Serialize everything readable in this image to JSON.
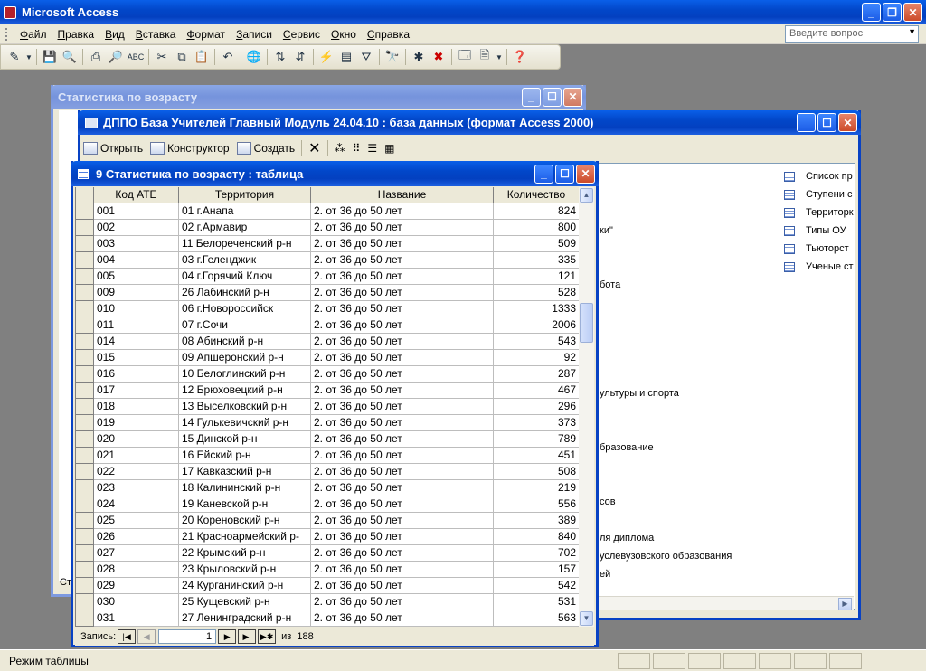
{
  "app": {
    "title": "Microsoft Access",
    "menu": [
      "Файл",
      "Правка",
      "Вид",
      "Вставка",
      "Формат",
      "Записи",
      "Сервис",
      "Окно",
      "Справка"
    ],
    "ask_placeholder": "Введите вопрос"
  },
  "report_window": {
    "title": "Статистика по возрасту",
    "footer_fragment": "Ст"
  },
  "db_window": {
    "title": "ДППО База Учителей Главный Модуль 24.04.10 : база данных (формат Access 2000)",
    "toolbar": {
      "open": "Открыть",
      "design": "Конструктор",
      "create": "Создать"
    },
    "objects_right": [
      "Список пр",
      "Ступени с",
      "Территорк",
      "Типы ОУ",
      "Тьюторст",
      "Ученые ст"
    ],
    "fragments": [
      "ки\"",
      "бота",
      "ультуры и спорта",
      "бразование",
      "сов",
      "ля диплома",
      "услевузовского образования",
      "ей"
    ]
  },
  "table_window": {
    "title": "9 Статистика по возрасту : таблица",
    "columns": [
      "Код АТЕ",
      "Территория",
      "Название",
      "Количество"
    ],
    "rows": [
      [
        "001",
        "01 г.Анапа",
        "2. от 36 до 50 лет",
        "824"
      ],
      [
        "002",
        "02 г.Армавир",
        "2. от 36 до 50 лет",
        "800"
      ],
      [
        "003",
        "11 Белореченский р-н",
        "2. от 36 до 50 лет",
        "509"
      ],
      [
        "004",
        "03 г.Геленджик",
        "2. от 36 до 50 лет",
        "335"
      ],
      [
        "005",
        "04 г.Горячий Ключ",
        "2. от 36 до 50 лет",
        "121"
      ],
      [
        "009",
        "26 Лабинский р-н",
        "2. от 36 до 50 лет",
        "528"
      ],
      [
        "010",
        "06 г.Новороссийск",
        "2. от 36 до 50 лет",
        "1333"
      ],
      [
        "011",
        "07 г.Сочи",
        "2. от 36 до 50 лет",
        "2006"
      ],
      [
        "014",
        "08 Абинский р-н",
        "2. от 36 до 50 лет",
        "543"
      ],
      [
        "015",
        "09 Апшеронский р-н",
        "2. от 36 до 50 лет",
        "92"
      ],
      [
        "016",
        "10 Белоглинский р-н",
        "2. от 36 до 50 лет",
        "287"
      ],
      [
        "017",
        "12 Брюховецкий р-н",
        "2. от 36 до 50 лет",
        "467"
      ],
      [
        "018",
        "13 Выселковский р-н",
        "2. от 36 до 50 лет",
        "296"
      ],
      [
        "019",
        "14 Гулькевичский р-н",
        "2. от 36 до 50 лет",
        "373"
      ],
      [
        "020",
        "15 Динской р-н",
        "2. от 36 до 50 лет",
        "789"
      ],
      [
        "021",
        "16 Ейский р-н",
        "2. от 36 до 50 лет",
        "451"
      ],
      [
        "022",
        "17 Кавказский р-н",
        "2. от 36 до 50 лет",
        "508"
      ],
      [
        "023",
        "18 Калининский р-н",
        "2. от 36 до 50 лет",
        "219"
      ],
      [
        "024",
        "19 Каневской р-н",
        "2. от 36 до 50 лет",
        "556"
      ],
      [
        "025",
        "20 Кореновский р-н",
        "2. от 36 до 50 лет",
        "389"
      ],
      [
        "026",
        "21 Красноармейский р-",
        "2. от 36 до 50 лет",
        "840"
      ],
      [
        "027",
        "22 Крымский р-н",
        "2. от 36 до 50 лет",
        "702"
      ],
      [
        "028",
        "23 Крыловский р-н",
        "2. от 36 до 50 лет",
        "157"
      ],
      [
        "029",
        "24 Курганинский р-н",
        "2. от 36 до 50 лет",
        "542"
      ],
      [
        "030",
        "25 Кущевский р-н",
        "2. от 36 до 50 лет",
        "531"
      ],
      [
        "031",
        "27 Ленинградский р-н",
        "2. от 36 до 50 лет",
        "563"
      ]
    ],
    "nav": {
      "label": "Запись:",
      "current": "1",
      "of_label": "из",
      "total": "188"
    }
  },
  "status": {
    "text": "Режим таблицы"
  }
}
